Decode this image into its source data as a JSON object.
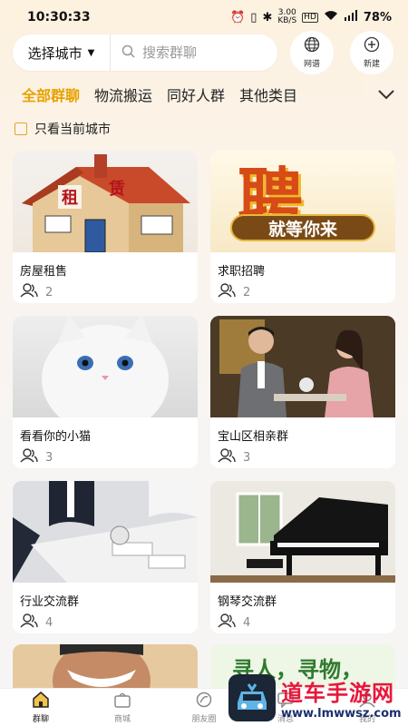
{
  "status_bar": {
    "time": "10:30:33",
    "net_speed_top": "3.00",
    "net_speed_bottom": "KB/S",
    "hd": "HD",
    "battery": "78%"
  },
  "header": {
    "city_select": "选择城市",
    "search_placeholder": "搜索群聊",
    "network_label": "网谱",
    "new_label": "新建"
  },
  "tabs": [
    {
      "label": "全部群聊",
      "active": true
    },
    {
      "label": "物流搬运",
      "active": false
    },
    {
      "label": "同好人群",
      "active": false
    },
    {
      "label": "其他类目",
      "active": false
    }
  ],
  "filter": {
    "label": "只看当前城市",
    "checked": false
  },
  "cards": [
    {
      "title": "房屋租售",
      "count": "2",
      "image": "house-rent-image",
      "image_text_1": "租",
      "image_text_2": "赁"
    },
    {
      "title": "求职招聘",
      "count": "2",
      "image": "recruit-poster-image",
      "image_text_1": "聘",
      "image_text_2": "就等你来"
    },
    {
      "title": "看看你的小猫",
      "count": "3",
      "image": "white-kitten-image"
    },
    {
      "title": "宝山区相亲群",
      "count": "3",
      "image": "couple-dating-image"
    },
    {
      "title": "行业交流群",
      "count": "4",
      "image": "business-meeting-image"
    },
    {
      "title": "钢琴交流群",
      "count": "4",
      "image": "piano-room-image"
    },
    {
      "title": "",
      "count": "",
      "image": "smiling-man-image"
    },
    {
      "title": "",
      "count": "",
      "image": "lost-found-image",
      "image_text_1": "寻人，寻物，"
    }
  ],
  "bottom_nav": [
    {
      "label": "群聊",
      "icon": "home-icon",
      "active": true
    },
    {
      "label": "商城",
      "icon": "shopping-bag-icon",
      "active": false
    },
    {
      "label": "朋友圈",
      "icon": "moments-icon",
      "active": false
    },
    {
      "label": "消息",
      "icon": "message-icon",
      "active": false
    },
    {
      "label": "我的",
      "icon": "profile-icon",
      "active": false
    }
  ],
  "watermark": {
    "text": "道车手游网",
    "url": "www.lmwwsz.com"
  },
  "colors": {
    "accent": "#e6a200",
    "checkbox_border": "#e0a530",
    "watermark_red": "#e8173a"
  }
}
